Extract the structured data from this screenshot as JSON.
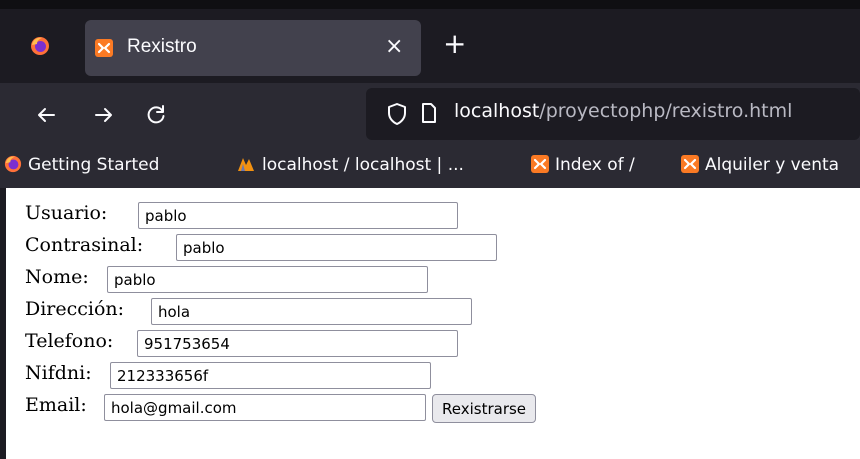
{
  "browser": {
    "tab": {
      "title": "Rexistro",
      "close": "×"
    },
    "new_tab": "+",
    "address": {
      "host": "localhost",
      "path": "/proyectophp/rexistro.html"
    },
    "bookmarks": [
      {
        "label": "Getting Started",
        "icon": "firefox-icon"
      },
      {
        "label": "localhost / localhost | ...",
        "icon": "phpmyadmin-icon"
      },
      {
        "label": "Index of /",
        "icon": "xampp-icon"
      },
      {
        "label": "Alquiler y venta",
        "icon": "xampp-icon"
      }
    ]
  },
  "form": {
    "fields": [
      {
        "label": "Usuario:",
        "value": "pablo"
      },
      {
        "label": "Contrasinal:",
        "value": "pablo"
      },
      {
        "label": "Nome:",
        "value": "pablo"
      },
      {
        "label": "Dirección:",
        "value": "hola"
      },
      {
        "label": "Telefono:",
        "value": "951753654"
      },
      {
        "label": "Nifdni:",
        "value": "212333656f"
      },
      {
        "label": "Email:",
        "value": "hola@gmail.com"
      }
    ],
    "submit_label": "Rexistrarse"
  },
  "colors": {
    "chrome_dark": "#1c1b22",
    "toolbar": "#2b2a33",
    "tab_active": "#42414d",
    "xampp_orange": "#fb7a24"
  }
}
